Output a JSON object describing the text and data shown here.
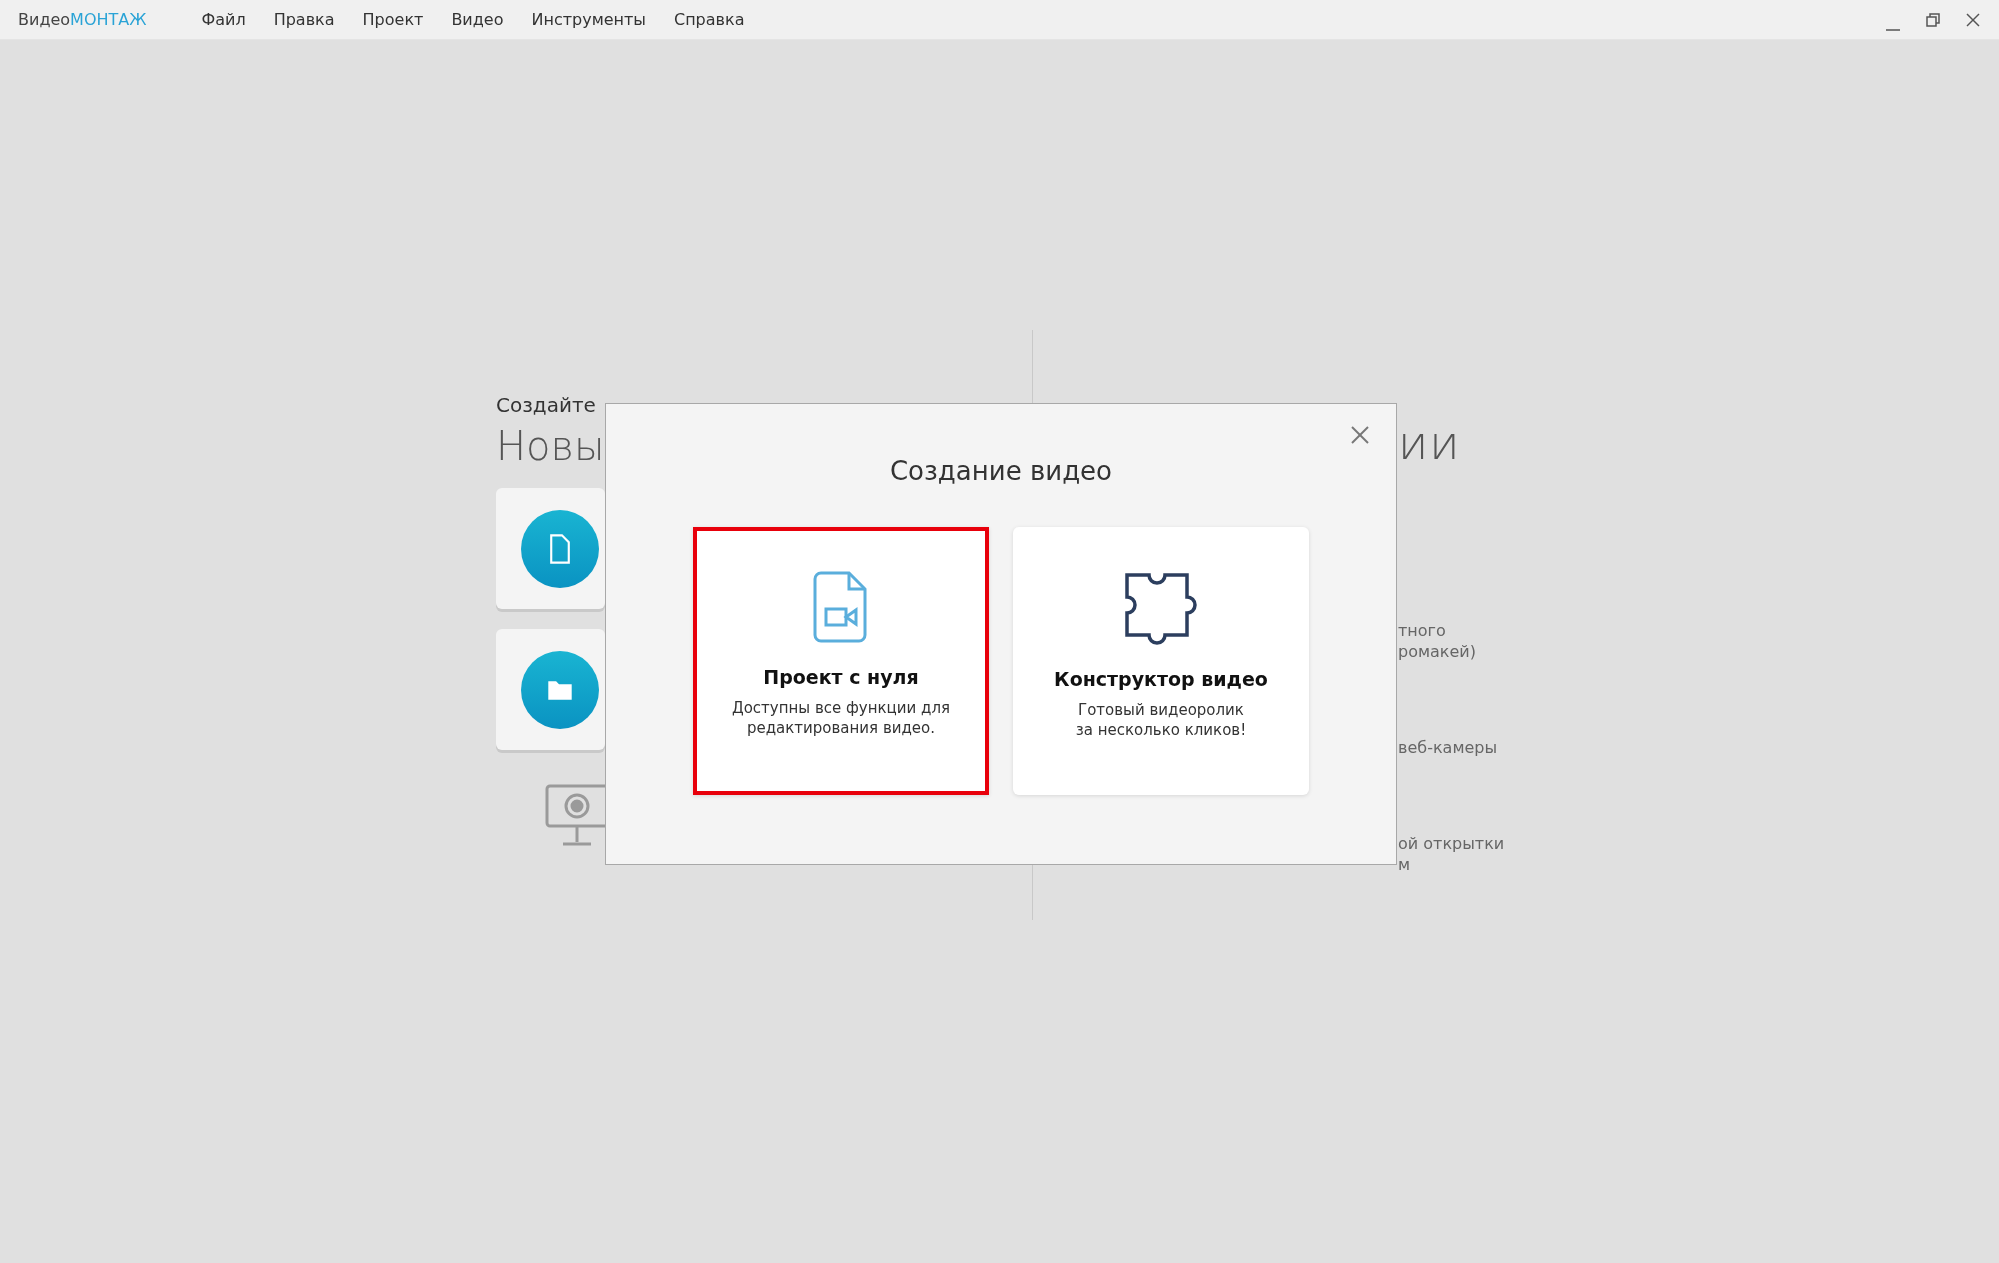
{
  "app": {
    "logo_prefix": "Видео",
    "logo_suffix": "МОНТАЖ"
  },
  "menu": [
    "Файл",
    "Правка",
    "Проект",
    "Видео",
    "Инструменты",
    "Справка"
  ],
  "background": {
    "left": {
      "subtitle": "Создайте",
      "title": "Новы",
      "tiles": [
        {
          "kind": "new"
        },
        {
          "kind": "open"
        }
      ]
    },
    "right": {
      "title": "ии",
      "fragment_groups": [
        [
          "тного",
          "ромакей)"
        ],
        [
          "веб-камеры"
        ],
        [
          "ой открытки",
          "м"
        ]
      ]
    }
  },
  "dialog": {
    "title": "Создание видео",
    "options": [
      {
        "kind": "blank",
        "title": "Проект с нуля",
        "description": "Доступны все функции для\nредактирования видео.",
        "selected": true
      },
      {
        "kind": "puzzle",
        "title": "Конструктор видео",
        "description": "Готовый видеоролик\nза несколько кликов!",
        "selected": false
      }
    ]
  }
}
